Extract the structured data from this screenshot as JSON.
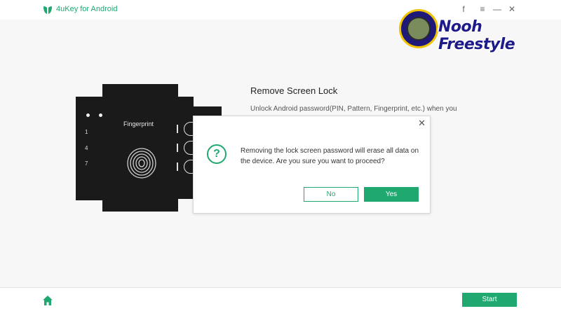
{
  "app": {
    "title": "4uKey for Android"
  },
  "window_controls": [
    {
      "name": "facebook-icon",
      "glyph": "f"
    },
    {
      "name": "menu-icon",
      "glyph": "≡"
    },
    {
      "name": "minimize-icon",
      "glyph": "—"
    },
    {
      "name": "close-window-icon",
      "glyph": "✕"
    }
  ],
  "illustration": {
    "label": "Fingerprint",
    "pins": [
      "1",
      "4",
      "7"
    ]
  },
  "feature": {
    "title": "Remove Screen Lock",
    "description": "Unlock Android password(PIN, Pattern, Fingerprint, etc.) when you"
  },
  "dialog": {
    "close_glyph": "✕",
    "icon_glyph": "?",
    "message": "Removing the lock screen password will erase all data on the device. Are you sure you want to proceed?",
    "no_label": "No",
    "yes_label": "Yes"
  },
  "bottom": {
    "start_label": "Start"
  },
  "watermark": {
    "text": "Nooh Freestyle"
  },
  "colors": {
    "accent": "#1fa971",
    "phone": "#1a1a1a",
    "watermark": "#1d1b8a"
  }
}
